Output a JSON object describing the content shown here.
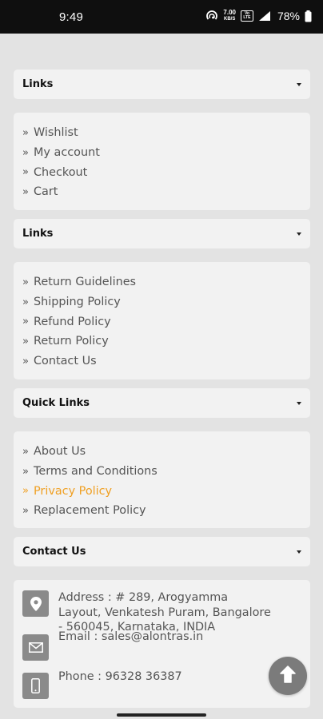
{
  "status_bar": {
    "time": "9:49",
    "net_speed_value": "7.00",
    "net_speed_unit": "KB/S",
    "volte_label": "Vo LTE",
    "battery": "78%"
  },
  "sections": [
    {
      "title": "Links",
      "items": [
        "Wishlist",
        "My account",
        "Checkout",
        "Cart"
      ]
    },
    {
      "title": "Links",
      "items": [
        "Return Guidelines",
        "Shipping Policy",
        "Refund Policy",
        "Return Policy",
        "Contact Us"
      ]
    },
    {
      "title": "Quick Links",
      "items": [
        "About Us",
        "Terms and Conditions",
        "Privacy Policy",
        "Replacement Policy"
      ]
    },
    {
      "title": "Contact Us",
      "address": "Address : # 289, Arogyamma Layout, Venkatesh Puram, Bangalore - 560045, Karnataka, INDIA",
      "email": "Email : sales@alontras.in",
      "phone": "Phone : 96328 36387"
    }
  ],
  "colors": {
    "active_link": "#f0a023",
    "background": "#e3e3e3",
    "panel": "#f2f2f2"
  },
  "icons": {
    "chevron": "»",
    "location": "map-marker-icon",
    "email": "envelope-icon",
    "phone": "mobile-phone-icon",
    "scroll_top": "arrow-up-icon"
  }
}
